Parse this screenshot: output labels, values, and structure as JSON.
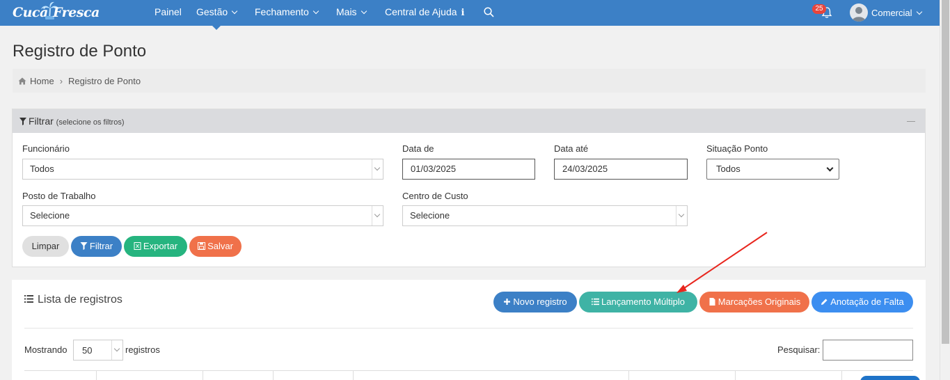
{
  "navbar": {
    "logo_word1": "Cucá",
    "logo_word2": "Fresca",
    "items": [
      {
        "label": "Painel"
      },
      {
        "label": "Gestão"
      },
      {
        "label": "Fechamento"
      },
      {
        "label": "Mais"
      },
      {
        "label": "Central de Ajuda"
      }
    ],
    "notifications_count": "25",
    "user_name": "Comercial"
  },
  "page": {
    "title": "Registro de Ponto",
    "breadcrumb": [
      "Home",
      "Registro de Ponto"
    ]
  },
  "filter": {
    "title": "Filtrar",
    "subtitle": "(selecione os filtros)",
    "funcionario_label": "Funcionário",
    "funcionario_value": "Todos",
    "data_de_label": "Data de",
    "data_de_value": "01/03/2025",
    "data_ate_label": "Data até",
    "data_ate_value": "24/03/2025",
    "situacao_label": "Situação Ponto",
    "situacao_value": "Todos",
    "posto_label": "Posto de Trabalho",
    "posto_value": "Selecione",
    "centro_label": "Centro de Custo",
    "centro_value": "Selecione",
    "buttons": {
      "limpar": "Limpar",
      "filtrar": "Filtrar",
      "exportar": "Exportar",
      "salvar": "Salvar"
    }
  },
  "list": {
    "title": "Lista de registros",
    "buttons": {
      "novo": "Novo registro",
      "multiplo": "Lançamento Múltiplo",
      "marcacoes": "Marcações Originais",
      "anotacao": "Anotação de Falta"
    },
    "showing_prefix": "Mostrando",
    "page_length": "50",
    "showing_suffix": "registros",
    "search_label": "Pesquisar:",
    "search_value": ""
  },
  "colors": {
    "navbar": "#3c80c6",
    "primary_blue": "#3c80c6",
    "green": "#26b47f",
    "orange": "#f0714a",
    "teal": "#3fb3a5",
    "light_blue": "#3c8ef0",
    "badge_red": "#e8453c",
    "annotation_red": "#e8261e"
  }
}
